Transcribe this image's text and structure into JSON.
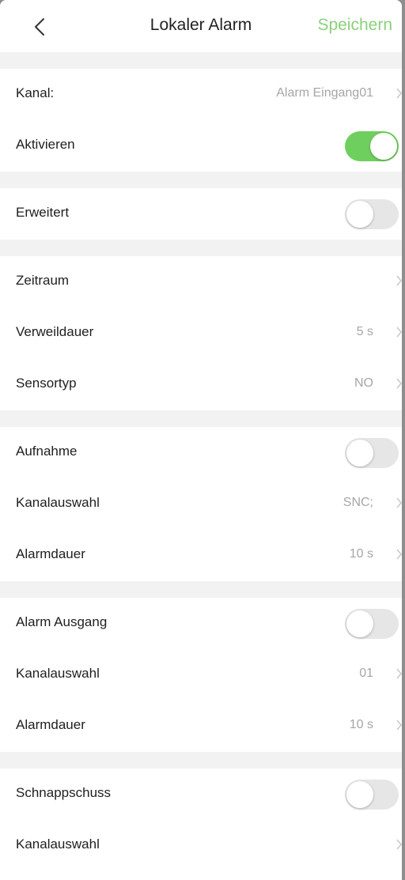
{
  "header": {
    "title": "Lokaler Alarm",
    "save_label": "Speichern"
  },
  "colors": {
    "accent": "#8ad17a",
    "toggle_on": "#6fcf5e",
    "toggle_off": "#e6e6e6",
    "section_gap": "#f2f2f2"
  },
  "rows": {
    "kanal": {
      "label": "Kanal:",
      "value": "Alarm Eingang01"
    },
    "aktivieren": {
      "label": "Aktivieren",
      "on": true
    },
    "erweitert": {
      "label": "Erweitert",
      "on": false
    },
    "zeitraum": {
      "label": "Zeitraum"
    },
    "verweildauer": {
      "label": "Verweildauer",
      "value": "5 s"
    },
    "sensortyp": {
      "label": "Sensortyp",
      "value": "NO"
    },
    "aufnahme": {
      "label": "Aufnahme",
      "on": false
    },
    "aufnahme_kanal": {
      "label": "Kanalauswahl",
      "value": "SNC;"
    },
    "aufnahme_dauer": {
      "label": "Alarmdauer",
      "value": "10 s"
    },
    "alarm_ausgang": {
      "label": "Alarm Ausgang",
      "on": false
    },
    "ausgang_kanal": {
      "label": "Kanalauswahl",
      "value": "01"
    },
    "ausgang_dauer": {
      "label": "Alarmdauer",
      "value": "10 s"
    },
    "schnappschuss": {
      "label": "Schnappschuss",
      "on": false
    },
    "schnapp_kanal": {
      "label": "Kanalauswahl"
    }
  }
}
